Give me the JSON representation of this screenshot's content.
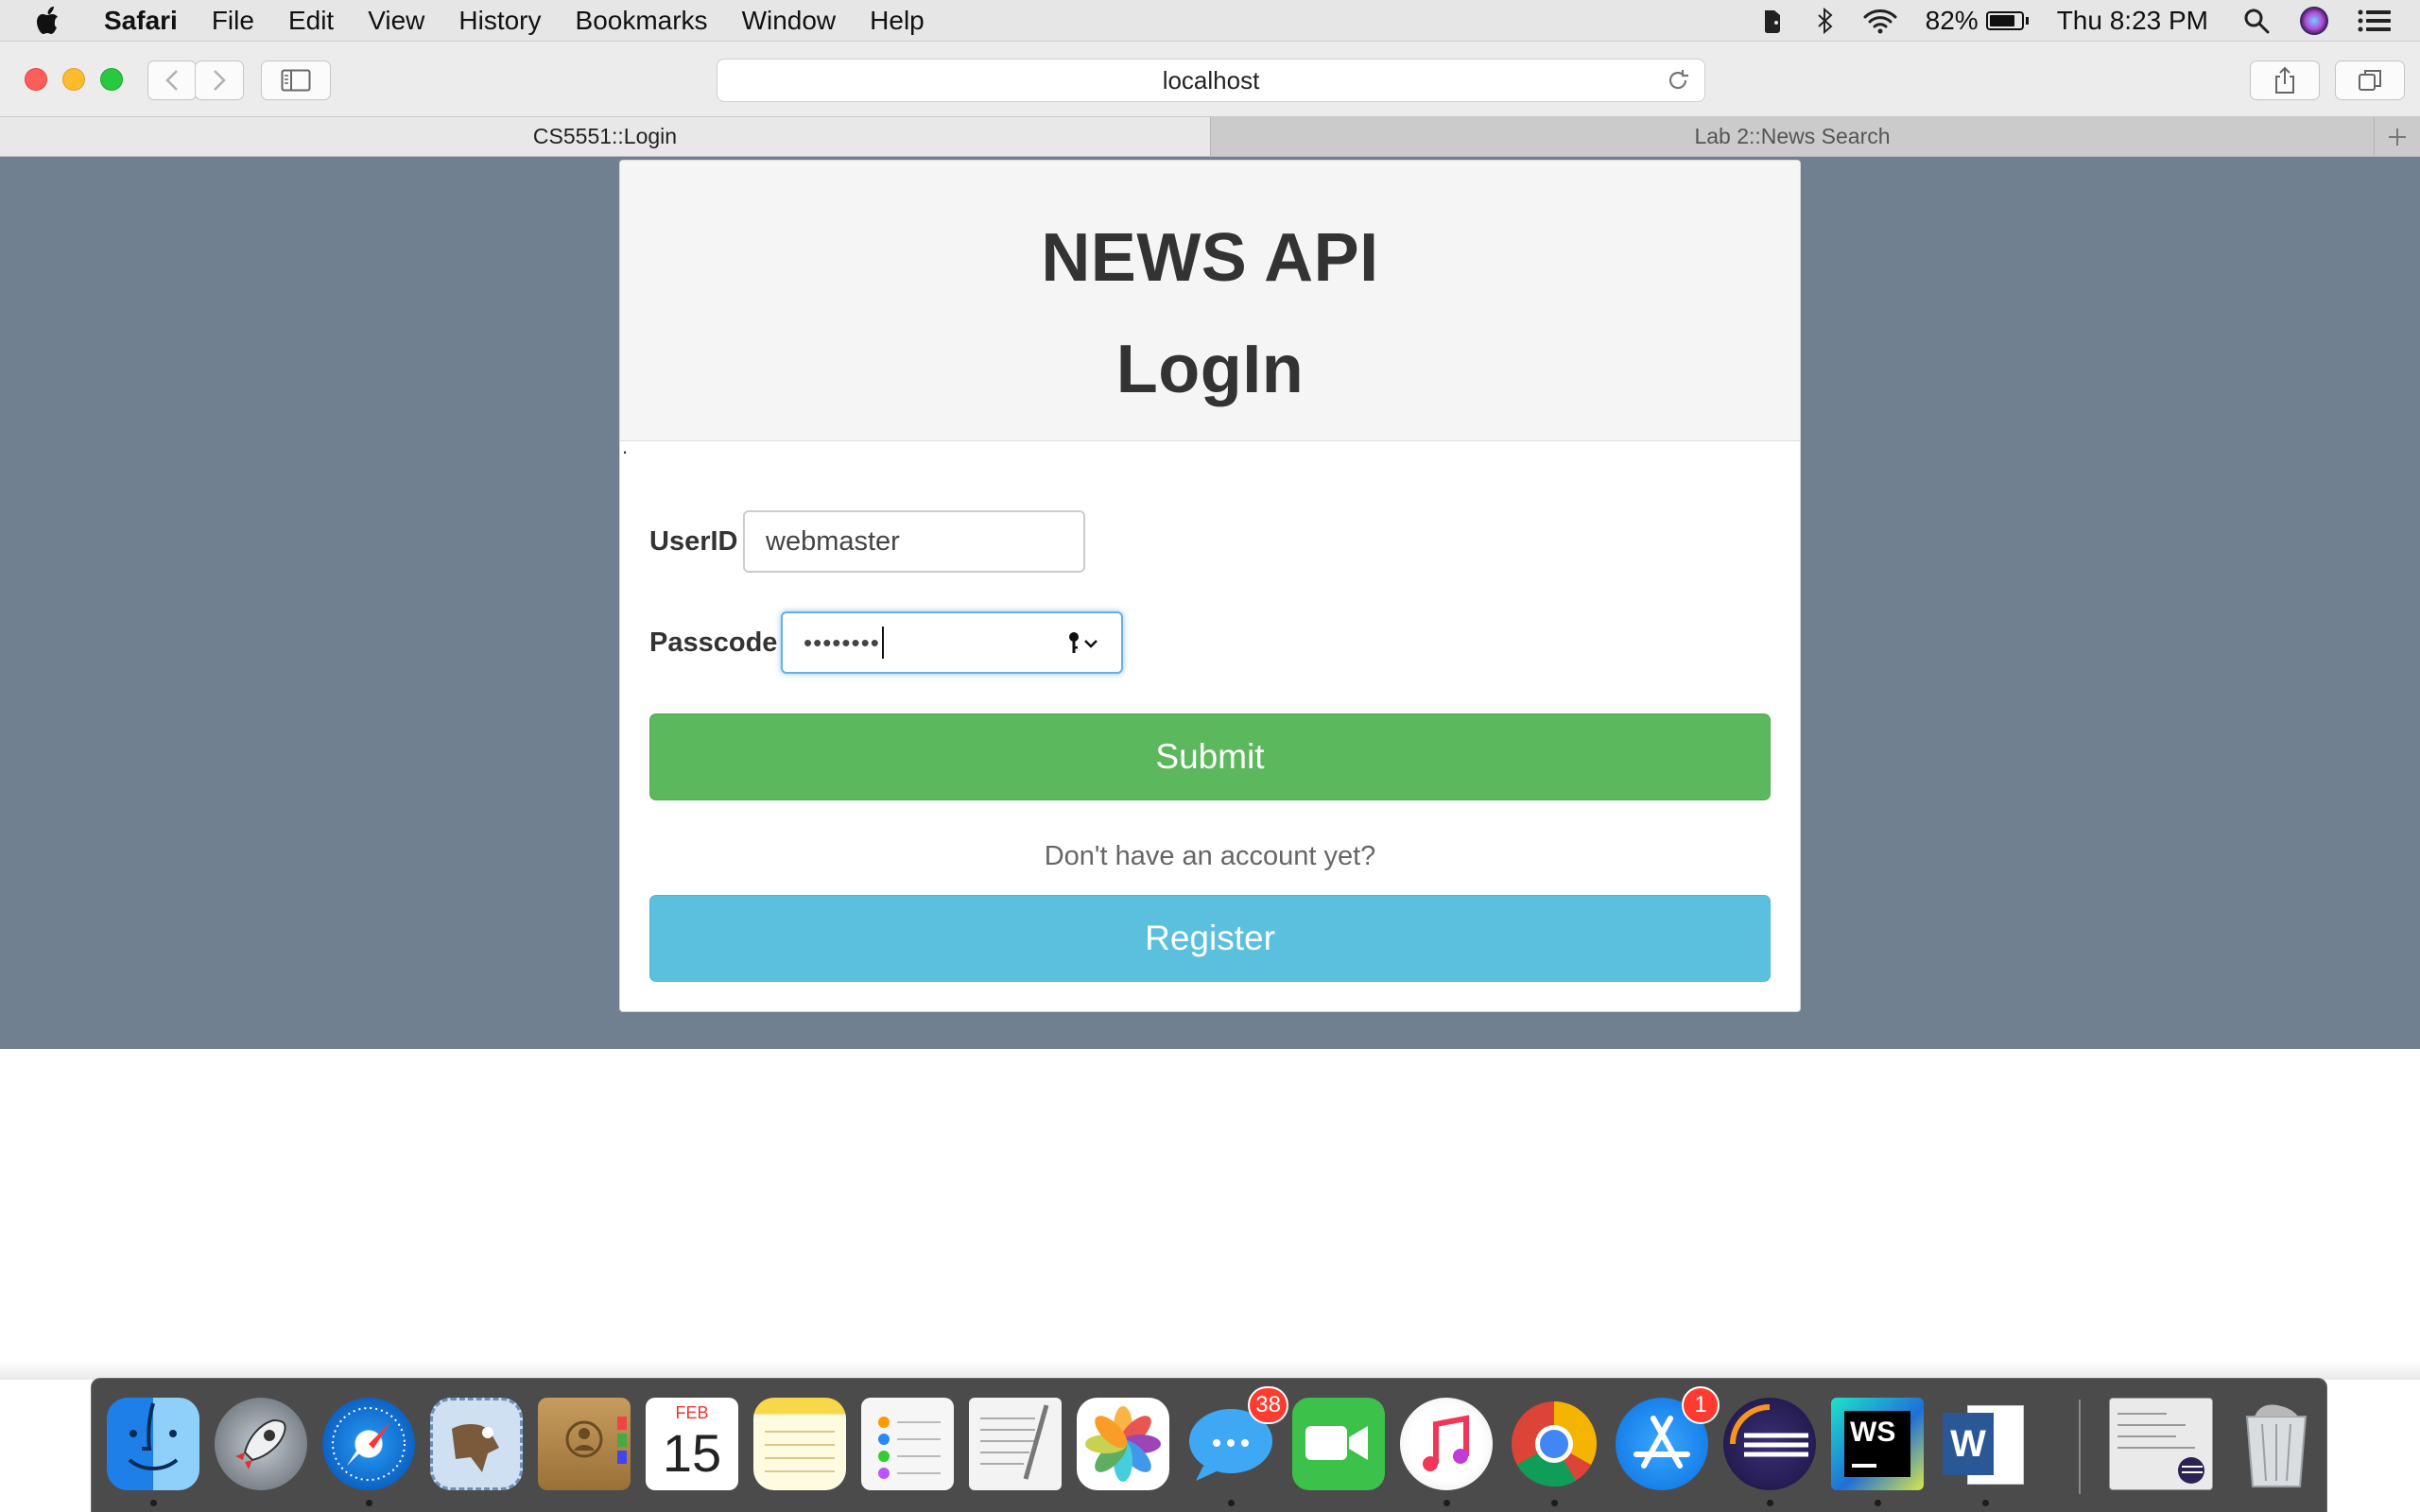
{
  "menubar": {
    "app_name": "Safari",
    "items": [
      "File",
      "Edit",
      "View",
      "History",
      "Bookmarks",
      "Window",
      "Help"
    ],
    "battery_percent": "82%",
    "battery_level": 0.82,
    "clock": "Thu 8:23 PM"
  },
  "browser": {
    "url": "localhost",
    "tabs": [
      {
        "label": "CS5551::Login",
        "active": true
      },
      {
        "label": "Lab 2::News Search",
        "active": false
      }
    ]
  },
  "page": {
    "title_line1": "NEWS API",
    "title_line2": "LogIn",
    "stray_text": ".",
    "userid_label": "UserID",
    "userid_value": "webmaster",
    "passcode_label": "Passcode",
    "passcode_masked": "••••••••",
    "submit_label": "Submit",
    "account_prompt": "Don't have an account yet?",
    "register_label": "Register"
  },
  "dock": {
    "calendar_month": "FEB",
    "calendar_day": "15",
    "messages_badge": "38",
    "appstore_badge": "1",
    "webstorm_label": "WS",
    "word_label": "W",
    "items": [
      {
        "name": "finder",
        "color": "#2f8cf0"
      },
      {
        "name": "launchpad",
        "color": "#8a9096"
      },
      {
        "name": "safari",
        "color": "#2a8ee8"
      },
      {
        "name": "mail",
        "color": "#7fa7d8"
      },
      {
        "name": "contacts",
        "color": "#b48a4a"
      },
      {
        "name": "calendar",
        "color": "#ffffff"
      },
      {
        "name": "notes",
        "color": "#f7d84a"
      },
      {
        "name": "reminders",
        "color": "#f4f4f4"
      },
      {
        "name": "textedit",
        "color": "#f2f2f2"
      },
      {
        "name": "photos",
        "color": "#ffffff"
      },
      {
        "name": "messages",
        "color": "#3fa8f5"
      },
      {
        "name": "facetime",
        "color": "#3cc14a"
      },
      {
        "name": "itunes",
        "color": "#f2f2f2"
      },
      {
        "name": "chrome",
        "color": "#ffffff"
      },
      {
        "name": "app-store",
        "color": "#1e8bf0"
      },
      {
        "name": "eclipse",
        "color": "#2c2255"
      },
      {
        "name": "webstorm",
        "color": "#1f9fd8"
      },
      {
        "name": "word",
        "color": "#2b5797"
      },
      {
        "name": "preview-window",
        "color": "#e8e8e8"
      },
      {
        "name": "trash",
        "color": "#cfd3d6"
      }
    ]
  }
}
